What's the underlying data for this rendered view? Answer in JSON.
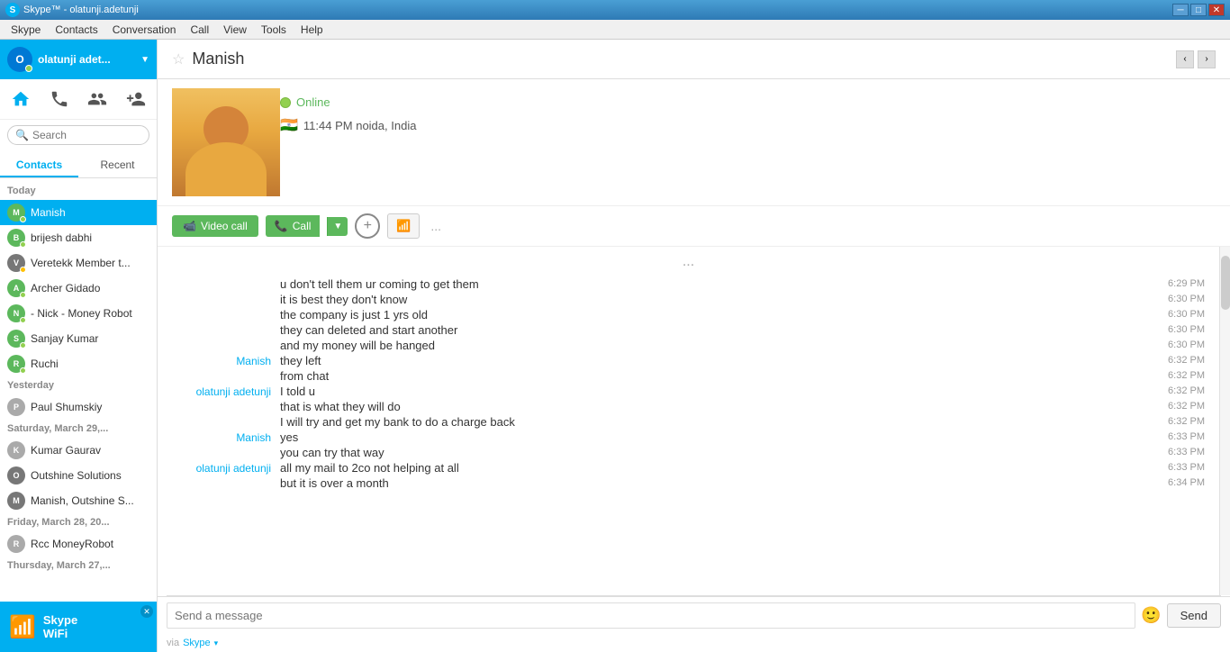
{
  "titlebar": {
    "title": "Skype™ - olatunji.adetunji",
    "icon": "S"
  },
  "menubar": {
    "items": [
      "Skype",
      "Contacts",
      "Conversation",
      "Call",
      "View",
      "Tools",
      "Help"
    ]
  },
  "profile": {
    "name": "olatunji adet...",
    "status": "online"
  },
  "search": {
    "placeholder": "Search",
    "value": ""
  },
  "tabs": {
    "contacts_label": "Contacts",
    "recent_label": "Recent"
  },
  "contacts": {
    "today_label": "Today",
    "yesterday_label": "Yesterday",
    "saturday_label": "Saturday, March 29,...",
    "friday_label": "Friday, March 28, 20...",
    "thursday_label": "Thursday, March 27,...",
    "today_items": [
      {
        "name": "Manish",
        "status": "online",
        "active": true
      },
      {
        "name": "brijesh dabhi",
        "status": "online"
      },
      {
        "name": "Veretekk Member t...",
        "status": "away"
      },
      {
        "name": "Archer Gidado",
        "status": "online"
      },
      {
        "name": "- Nick - Money Robot",
        "status": "online"
      },
      {
        "name": "Sanjay Kumar",
        "status": "online"
      },
      {
        "name": "Ruchi",
        "status": "online"
      }
    ],
    "yesterday_items": [
      {
        "name": "Paul Shumskiy",
        "status": "offline"
      }
    ],
    "saturday_items": [
      {
        "name": "Kumar Gaurav",
        "status": "offline"
      },
      {
        "name": "Outshine Solutions",
        "status": "group"
      },
      {
        "name": "Manish, Outshine S...",
        "status": "group"
      }
    ],
    "friday_items": [
      {
        "name": "Rcc MoneyRobot",
        "status": "offline"
      }
    ]
  },
  "wifi": {
    "label": "Skype",
    "sublabel": "WiFi"
  },
  "chat_header": {
    "contact_name": "Manish",
    "status": "Online",
    "location": "11:44 PM noida, India"
  },
  "chat_buttons": {
    "video_call": "Video call",
    "call": "Call",
    "dots": "..."
  },
  "messages": [
    {
      "sender": "",
      "text": "u don't tell them ur coming to get them",
      "time": "6:29 PM"
    },
    {
      "sender": "",
      "text": "it is best they don't know",
      "time": "6:30 PM"
    },
    {
      "sender": "",
      "text": "the company is just 1 yrs old",
      "time": "6:30 PM"
    },
    {
      "sender": "",
      "text": "they can deleted and start another",
      "time": "6:30 PM"
    },
    {
      "sender": "",
      "text": "and my money will be hanged",
      "time": "6:30 PM"
    },
    {
      "sender": "Manish",
      "text": "they left",
      "time": "6:32 PM"
    },
    {
      "sender": "",
      "text": "from chat",
      "time": "6:32 PM"
    },
    {
      "sender": "olatunji adetunji",
      "text": "I told u",
      "time": "6:32 PM"
    },
    {
      "sender": "",
      "text": "that is what they will do",
      "time": "6:32 PM"
    },
    {
      "sender": "",
      "text": "I will try and get my bank to do a charge back",
      "time": "6:32 PM"
    },
    {
      "sender": "Manish",
      "text": "yes",
      "time": "6:33 PM"
    },
    {
      "sender": "",
      "text": "you can try that way",
      "time": "6:33 PM"
    },
    {
      "sender": "olatunji adetunji",
      "text": "all my mail to 2co not helping at all",
      "time": "6:33 PM"
    },
    {
      "sender": "",
      "text": "but it is over a month",
      "time": "6:34 PM"
    }
  ],
  "message_input": {
    "placeholder": "Send a message",
    "send_label": "Send"
  },
  "via_bar": {
    "via_text": "via",
    "skype_link": "Skype"
  }
}
